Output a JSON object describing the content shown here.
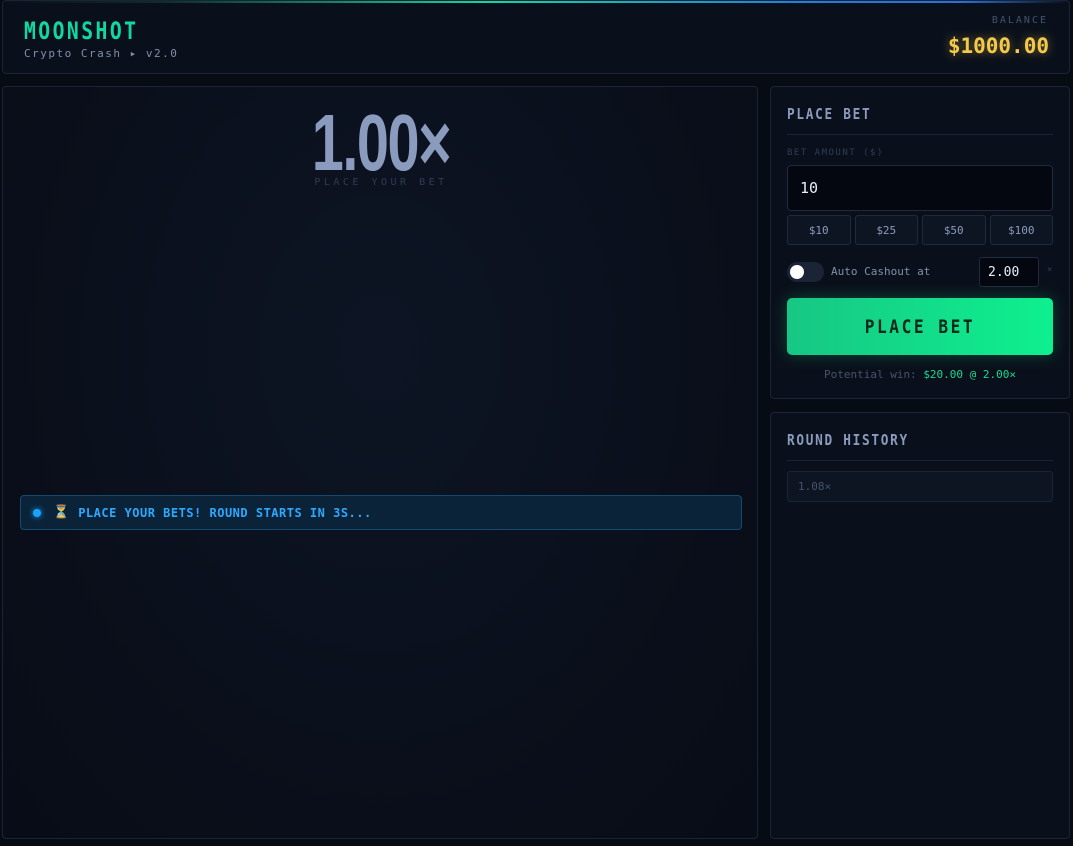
{
  "header": {
    "logo": "MOONSHOT",
    "subtitle": "Crypto Crash ▸ v2.0",
    "balance_label": "BALANCE",
    "balance_value": "$1000.00"
  },
  "game": {
    "multiplier": "1.00×",
    "caption": "PLACE YOUR BET",
    "status_icon": "hourglass-icon",
    "status_emoji": "⏳",
    "status_text": "PLACE YOUR BETS! ROUND STARTS IN 3S..."
  },
  "bet_panel": {
    "title": "PLACE BET",
    "amount_label": "BET AMOUNT ($)",
    "amount_value": "10",
    "quick_amounts": [
      "$10",
      "$25",
      "$50",
      "$100"
    ],
    "auto_cashout_label": "Auto Cashout at",
    "auto_cashout_enabled": false,
    "auto_cashout_value": "2.00",
    "auto_cashout_suffix": "×",
    "button_label": "PLACE BET",
    "potential_label": "Potential win:",
    "potential_value": "$20.00 @ 2.00×"
  },
  "history": {
    "title": "ROUND HISTORY",
    "rounds": [
      "1.08×"
    ]
  },
  "colors": {
    "accent_green": "#10d8a2",
    "balance_gold": "#f4c94a",
    "status_blue": "#2ea8ff",
    "button_green": "#0ef08f"
  }
}
